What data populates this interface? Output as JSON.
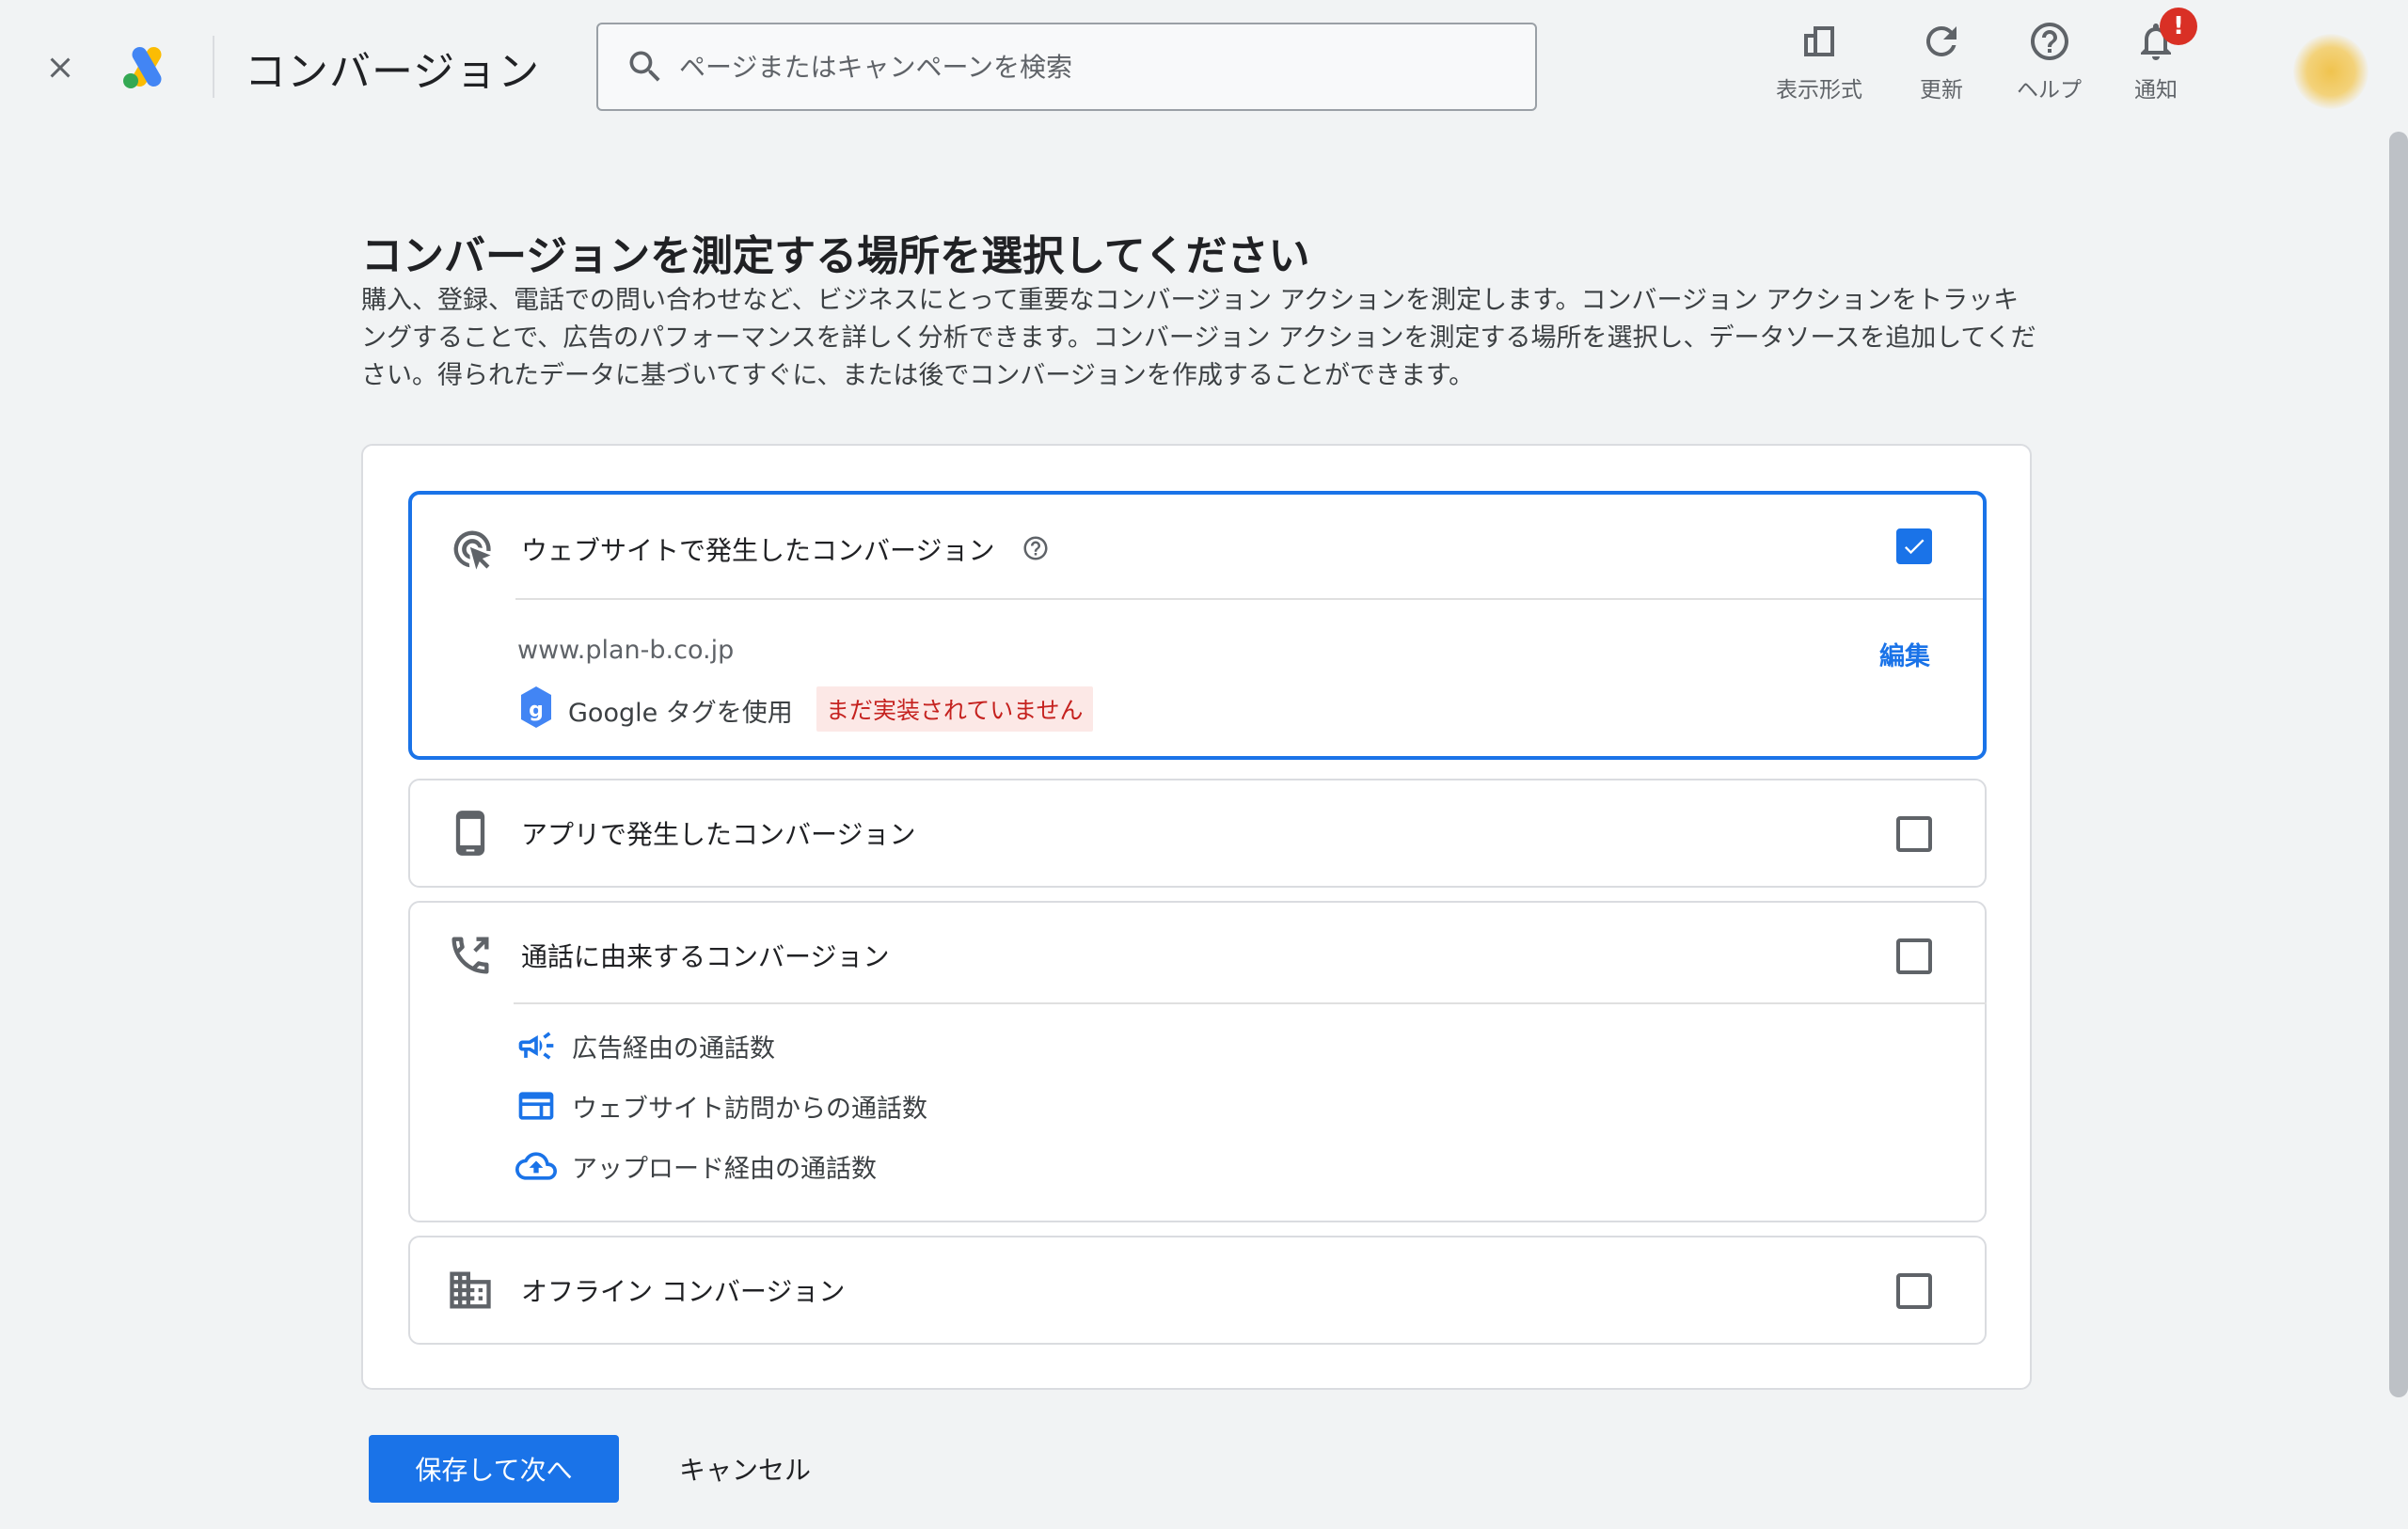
{
  "header": {
    "close_icon": "close-icon",
    "logo": "google-ads-logo",
    "title": "コンバージョン",
    "search": {
      "placeholder": "ページまたはキャンペーンを検索",
      "value": ""
    },
    "tools": [
      {
        "icon": "view-format-icon",
        "label": "表示形式"
      },
      {
        "icon": "refresh-icon",
        "label": "更新"
      },
      {
        "icon": "help-icon",
        "label": "ヘルプ"
      },
      {
        "icon": "notification-bell-icon",
        "label": "通知",
        "badge": "!"
      }
    ],
    "accent_color": "#1a73e8"
  },
  "main": {
    "title": "コンバージョンを測定する場所を選択してください",
    "description": "購入、登録、電話での問い合わせなど、ビジネスにとって重要なコンバージョン アクションを測定します。コンバージョン アクションをトラッキングすることで、広告のパフォーマンスを詳しく分析できます。コンバージョン アクションを測定する場所を選択し、データソースを追加してください。得られたデータに基づいてすぐに、または後でコンバージョンを作成することができます。",
    "options": {
      "website": {
        "label": "ウェブサイトで発生したコンバージョン",
        "checked": true,
        "url": "www.plan-b.co.jp",
        "edit_label": "編集",
        "tag_label": "Google タグを使用",
        "status": "まだ実装されていません",
        "status_color": "#c5221f"
      },
      "app": {
        "label": "アプリで発生したコンバージョン",
        "checked": false
      },
      "calls": {
        "label": "通話に由来するコンバージョン",
        "checked": false,
        "sub_items": [
          {
            "icon": "megaphone-icon",
            "label": "広告経由の通話数"
          },
          {
            "icon": "web-page-icon",
            "label": "ウェブサイト訪問からの通話数"
          },
          {
            "icon": "cloud-upload-icon",
            "label": "アップロード経由の通話数"
          }
        ]
      },
      "offline": {
        "label": "オフライン コンバージョン",
        "checked": false
      }
    }
  },
  "footer": {
    "save_label": "保存して次へ",
    "cancel_label": "キャンセル"
  }
}
